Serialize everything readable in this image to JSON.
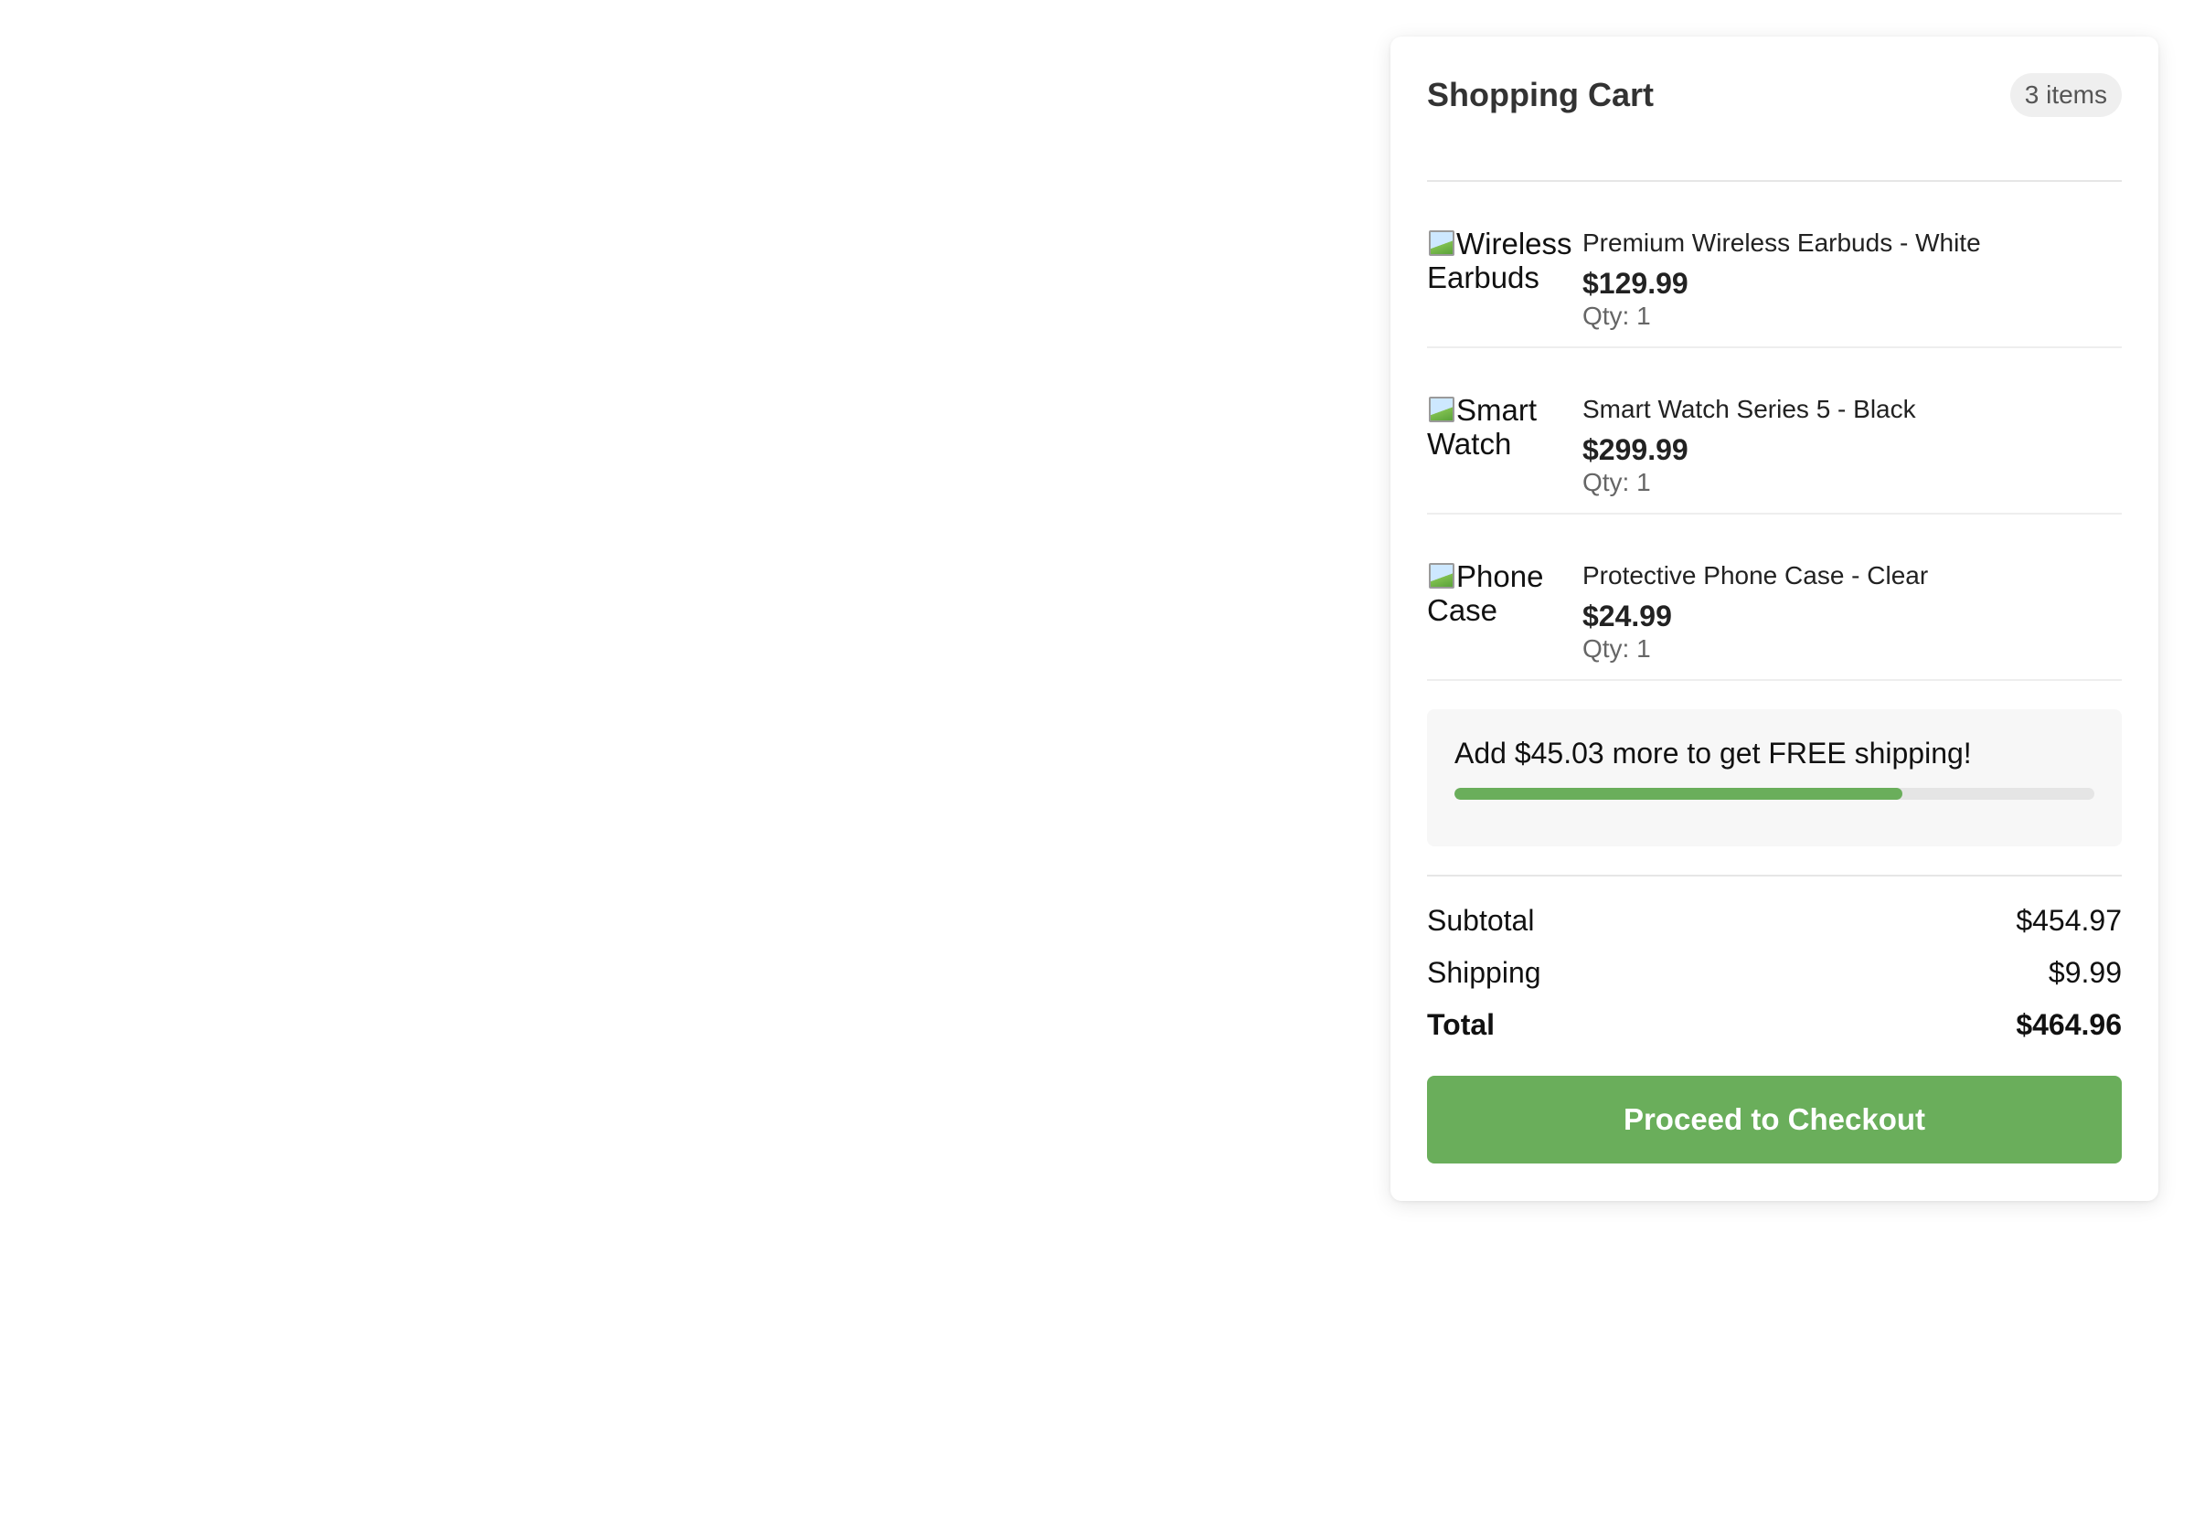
{
  "cart": {
    "title": "Shopping Cart",
    "item_count": "3 items",
    "items": [
      {
        "image_alt": "Wireless Earbuds",
        "name": "Premium Wireless Earbuds - White",
        "price": "$129.99",
        "qty": "Qty: 1"
      },
      {
        "image_alt": "Smart Watch",
        "name": "Smart Watch Series 5 - Black",
        "price": "$299.99",
        "qty": "Qty: 1"
      },
      {
        "image_alt": "Phone Case",
        "name": "Protective Phone Case - Clear",
        "price": "$24.99",
        "qty": "Qty: 1"
      }
    ],
    "free_shipping": {
      "message": "Add $45.03 more to get FREE shipping!",
      "progress_fraction": 0.7
    },
    "summary": {
      "subtotal_label": "Subtotal",
      "subtotal_value": "$454.97",
      "shipping_label": "Shipping",
      "shipping_value": "$9.99",
      "total_label": "Total",
      "total_value": "$464.96"
    },
    "checkout_label": "Proceed to Checkout"
  },
  "colors": {
    "accent": "#6aae5b",
    "badge_bg": "#efefef",
    "panel_bg": "#f7f7f7"
  }
}
